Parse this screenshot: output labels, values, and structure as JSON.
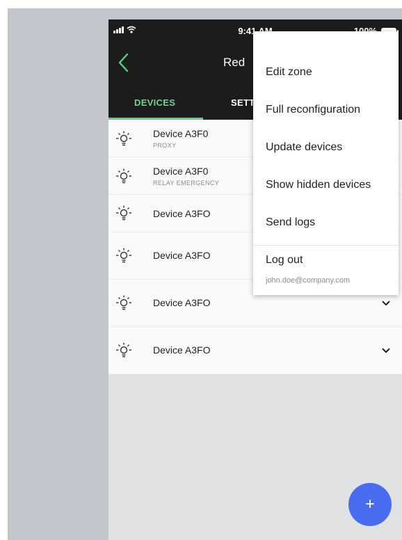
{
  "status_bar": {
    "time": "9:41 AM",
    "battery": "100%"
  },
  "app_bar": {
    "title": "Red"
  },
  "tabs": [
    {
      "label": "DEVICES",
      "active": true
    },
    {
      "label": "SETT",
      "active": false
    }
  ],
  "devices": [
    {
      "name": "Device A3F0",
      "sub": "PROXY"
    },
    {
      "name": "Device A3F0",
      "sub": "RELAY  EMERGENCY"
    },
    {
      "name": "Device A3FO",
      "sub": ""
    },
    {
      "name": "Device A3FO",
      "sub": ""
    },
    {
      "name": "Device A3FO",
      "sub": ""
    },
    {
      "name": "Device A3FO",
      "sub": ""
    }
  ],
  "menu": {
    "items": [
      "Edit zone",
      "Full reconfiguration",
      "Update devices",
      "Show hidden devices",
      "Send logs",
      "Log out"
    ],
    "email": "john.doe@company.com"
  },
  "fab": {
    "label": "+"
  },
  "colors": {
    "accent": "#5bd08a",
    "fab": "#4a6cf0",
    "app_bar": "#1c1c1c"
  },
  "icons": [
    "signal-icon",
    "wifi-icon",
    "battery-icon",
    "back-icon",
    "bulb-icon",
    "chevron-down-icon",
    "plus-icon"
  ]
}
